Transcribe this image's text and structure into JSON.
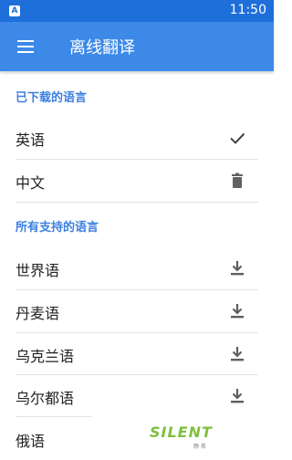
{
  "status_bar": {
    "app_icon_letter": "A",
    "time": "11:50"
  },
  "app_bar": {
    "menu_icon": "menu-icon",
    "title": "离线翻译"
  },
  "downloaded": {
    "header": "已下载的语言",
    "items": [
      {
        "label": "英语",
        "icon": "check-icon"
      },
      {
        "label": "中文",
        "icon": "trash-icon"
      }
    ]
  },
  "supported": {
    "header": "所有支持的语言",
    "items": [
      {
        "label": "世界语",
        "icon": "download-icon"
      },
      {
        "label": "丹麦语",
        "icon": "download-icon"
      },
      {
        "label": "乌克兰语",
        "icon": "download-icon"
      },
      {
        "label": "乌尔都语",
        "icon": "download-icon"
      },
      {
        "label": "俄语",
        "icon": ""
      }
    ]
  },
  "watermark": {
    "text": "SILENT",
    "sub": "静 茶"
  },
  "colors": {
    "status_bar": "#1e6fd9",
    "app_bar": "#3d89e8",
    "section_header": "#3d7fe0",
    "icon": "#5f5f5f"
  }
}
